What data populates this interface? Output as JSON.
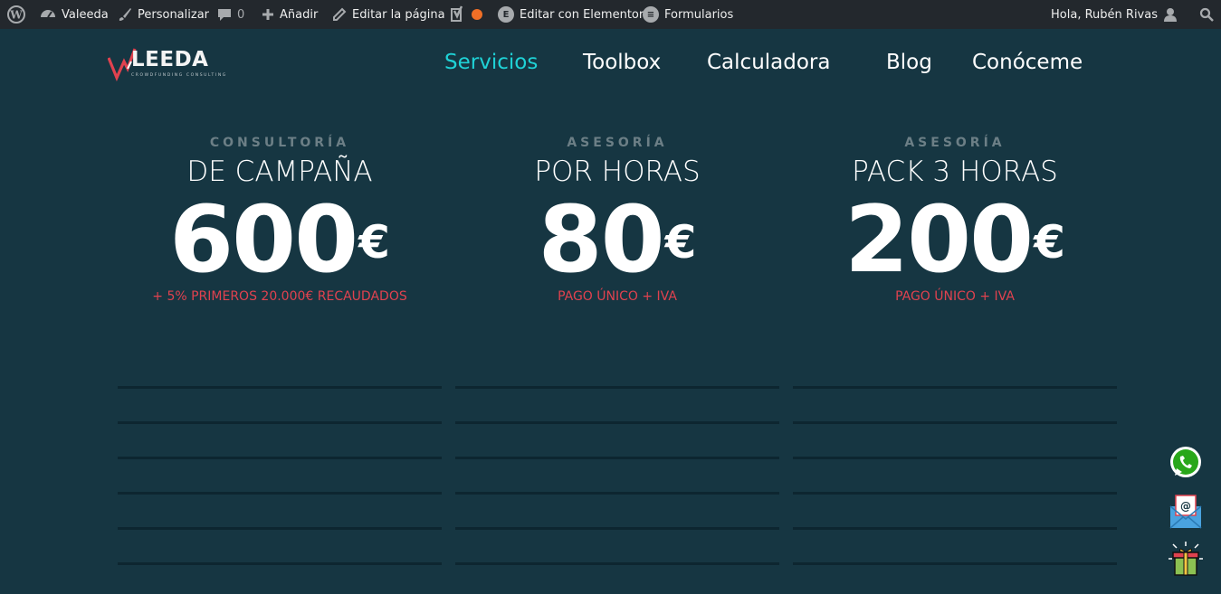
{
  "adminbar": {
    "site_name": "Valeeda",
    "customize": "Personalizar",
    "comments_count": "0",
    "add_new": "Añadir",
    "edit_page": "Editar la página",
    "elementor": "Editar con Elementor",
    "forms": "Formularios",
    "greeting": "Hola, Rubén Rivas"
  },
  "logo": {
    "text": "LEEDA",
    "tagline": "CROWDFUNDING CONSULTING"
  },
  "nav": {
    "items": [
      "Servicios",
      "Toolbox",
      "Calculadora",
      "Blog",
      "Conóceme"
    ],
    "active_color": "#1fd2d6"
  },
  "plans": [
    {
      "kicker": "CONSULTORÍA",
      "title": "DE CAMPAÑA",
      "price": "600",
      "currency": "€",
      "note": "+ 5% PRIMEROS 20.000€ RECAUDADOS"
    },
    {
      "kicker": "ASESORÍA",
      "title": "POR HORAS",
      "price": "80",
      "currency": "€",
      "note": "PAGO ÚNICO + IVA"
    },
    {
      "kicker": "ASESORÍA",
      "title": "PACK 3 HORAS",
      "price": "200",
      "currency": "€",
      "note": "PAGO ÚNICO + IVA"
    }
  ],
  "colors": {
    "background": "#163642",
    "adminbar": "#23282d",
    "accent_red": "#e0424f"
  },
  "floating": [
    "whatsapp-icon",
    "email-icon",
    "gift-icon"
  ]
}
